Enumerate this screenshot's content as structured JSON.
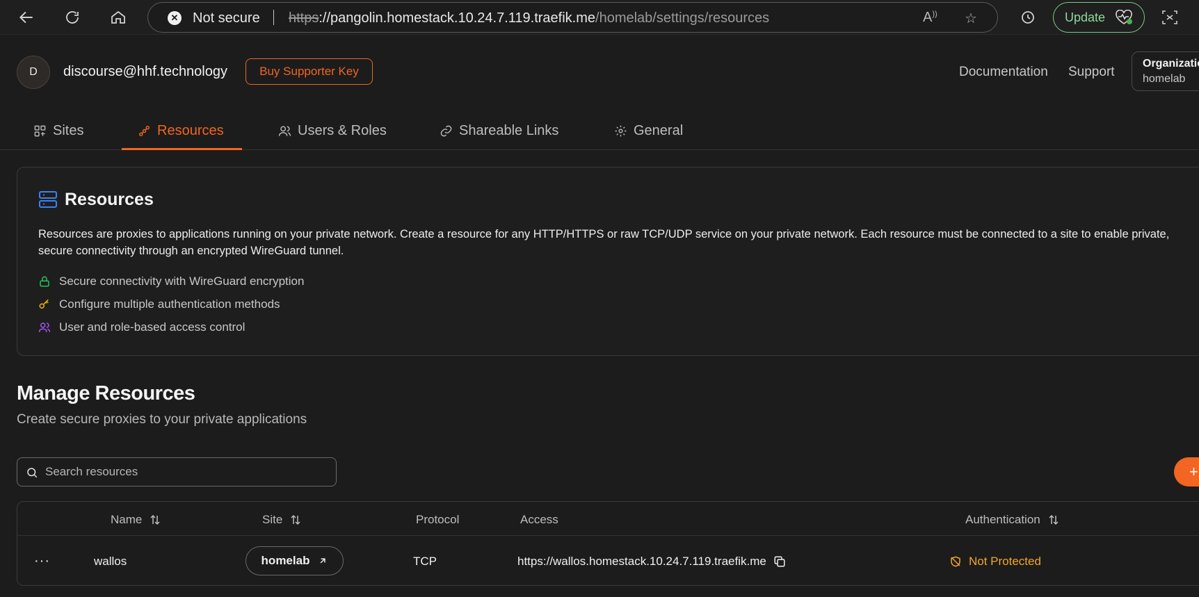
{
  "browser": {
    "security_label": "Not secure",
    "url_scheme": "https",
    "url_host": "://pangolin.homestack.10.24.7.119.traefik.me",
    "url_path": "/homelab/settings/resources",
    "update_label": "Update"
  },
  "header": {
    "avatar_initial": "D",
    "user_email": "discourse@hhf.technology",
    "supporter_button": "Buy Supporter Key",
    "documentation_link": "Documentation",
    "support_link": "Support",
    "org_label": "Organization",
    "org_value": "homelab"
  },
  "tabs": [
    {
      "label": "Sites"
    },
    {
      "label": "Resources"
    },
    {
      "label": "Users & Roles"
    },
    {
      "label": "Shareable Links"
    },
    {
      "label": "General"
    }
  ],
  "info_card": {
    "title": "Resources",
    "description": "Resources are proxies to applications running on your private network. Create a resource for any HTTP/HTTPS or raw TCP/UDP service on your private network. Each resource must be connected to a site to enable private, secure connectivity through an encrypted WireGuard tunnel.",
    "features": [
      "Secure connectivity with WireGuard encryption",
      "Configure multiple authentication methods",
      "User and role-based access control"
    ]
  },
  "manage": {
    "title": "Manage Resources",
    "subtitle": "Create secure proxies to your private applications",
    "search_placeholder": "Search resources",
    "add_label": "+"
  },
  "table": {
    "columns": [
      "Name",
      "Site",
      "Protocol",
      "Access",
      "Authentication"
    ],
    "rows": [
      {
        "menu": "···",
        "name": "wallos",
        "site": "homelab",
        "protocol": "TCP",
        "access": "https://wallos.homestack.10.24.7.119.traefik.me",
        "authentication": "Not Protected"
      }
    ]
  },
  "colors": {
    "accent": "#f26522",
    "warning": "#f5a623",
    "success": "#22c55e",
    "info": "#3b82f6",
    "purple": "#a855f7"
  }
}
